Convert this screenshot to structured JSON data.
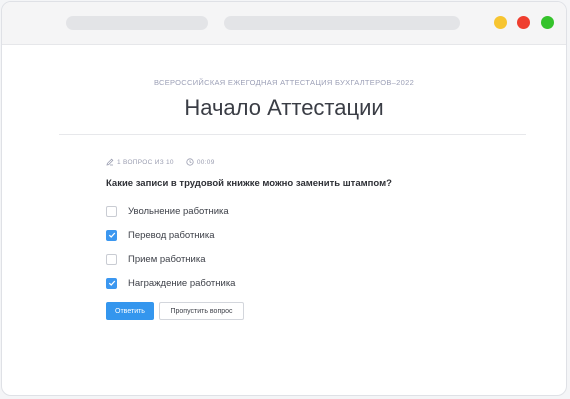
{
  "window": {
    "colors": {
      "close": "#ef3e2f",
      "minimize": "#f7c531",
      "maximize": "#35c32c",
      "accent": "#3496ee"
    }
  },
  "header": {
    "subtitle": "ВСЕРОССИЙСКАЯ ЕЖЕГОДНАЯ АТТЕСТАЦИЯ БУХГАЛТЕРОВ–2022",
    "title": "Начало Аттестации"
  },
  "meta": {
    "progress_icon": "pencil-icon",
    "progress": "1 ВОПРОС ИЗ 10",
    "timer_icon": "clock-icon",
    "timer": "00:09"
  },
  "quiz": {
    "question": "Какие записи в трудовой книжке можно заменить штампом?",
    "options": [
      {
        "label": "Увольнение работника",
        "checked": false
      },
      {
        "label": "Перевод работника",
        "checked": true
      },
      {
        "label": "Прием работника",
        "checked": false
      },
      {
        "label": "Награждение работника",
        "checked": true
      }
    ]
  },
  "actions": {
    "answer_label": "Ответить",
    "skip_label": "Пропустить вопрос"
  }
}
